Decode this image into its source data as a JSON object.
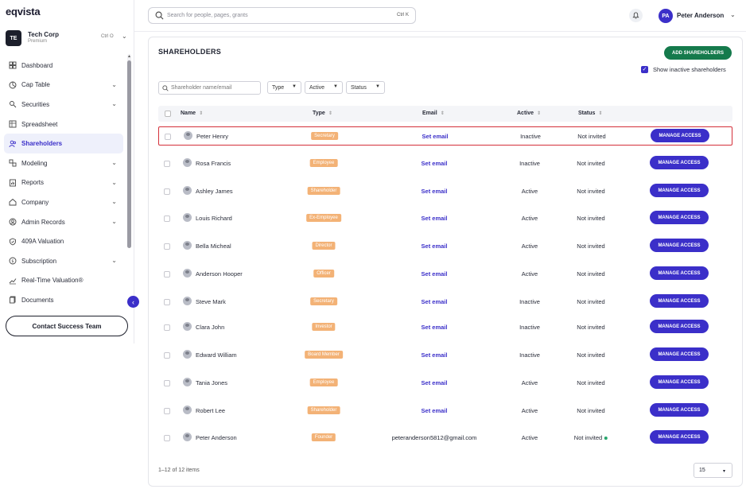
{
  "app": {
    "logo": "eqvista"
  },
  "company": {
    "initials": "TE",
    "name": "Tech Corp",
    "plan": "Premium",
    "shortcut": "Ctrl O"
  },
  "sidebar": {
    "items": [
      {
        "label": "Dashboard",
        "icon": "dashboard-icon",
        "has_chevron": false,
        "active": false
      },
      {
        "label": "Cap Table",
        "icon": "cap-table-icon",
        "has_chevron": true,
        "active": false
      },
      {
        "label": "Securities",
        "icon": "securities-icon",
        "has_chevron": true,
        "active": false
      },
      {
        "label": "Spreadsheet",
        "icon": "spreadsheet-icon",
        "has_chevron": false,
        "active": false
      },
      {
        "label": "Shareholders",
        "icon": "users-icon",
        "has_chevron": false,
        "active": true
      },
      {
        "label": "Modeling",
        "icon": "modeling-icon",
        "has_chevron": true,
        "active": false
      },
      {
        "label": "Reports",
        "icon": "reports-icon",
        "has_chevron": true,
        "active": false
      },
      {
        "label": "Company",
        "icon": "company-icon",
        "has_chevron": true,
        "active": false
      },
      {
        "label": "Admin Records",
        "icon": "admin-records-icon",
        "has_chevron": true,
        "active": false
      },
      {
        "label": "409A Valuation",
        "icon": "shield-icon",
        "has_chevron": false,
        "active": false
      },
      {
        "label": "Subscription",
        "icon": "subscription-icon",
        "has_chevron": true,
        "active": false
      },
      {
        "label": "Real-Time Valuation®",
        "icon": "chart-line-icon",
        "has_chevron": false,
        "active": false
      },
      {
        "label": "Documents",
        "icon": "documents-icon",
        "has_chevron": false,
        "active": false
      }
    ],
    "contact_button": "Contact Success Team"
  },
  "topbar": {
    "search_placeholder": "Search for people, pages, grants",
    "search_shortcut": "Ctrl K",
    "user_initials": "PA",
    "user_name": "Peter Anderson"
  },
  "main": {
    "title": "SHAREHOLDERS",
    "add_button": "ADD SHAREHOLDERS",
    "show_inactive_label": "Show inactive shareholders",
    "show_inactive_checked": true,
    "filter_placeholder": "Shareholder name/email",
    "filters": {
      "type": "Type",
      "active": "Active",
      "status": "Status"
    },
    "columns": {
      "name": "Name",
      "type": "Type",
      "email": "Email",
      "active": "Active",
      "status": "Status"
    },
    "manage_label": "MANAGE ACCESS",
    "rows": [
      {
        "name": "Peter Henry",
        "type": "Secretary",
        "email": "Set email",
        "active": "Inactive",
        "status": "Not invited"
      },
      {
        "name": "Rosa Francis",
        "type": "Employee",
        "email": "Set email",
        "active": "Inactive",
        "status": "Not invited"
      },
      {
        "name": "Ashley James",
        "type": "Shareholder",
        "email": "Set email",
        "active": "Active",
        "status": "Not invited"
      },
      {
        "name": "Louis Richard",
        "type": "Ex-Employee",
        "email": "Set email",
        "active": "Active",
        "status": "Not invited"
      },
      {
        "name": "Bella Micheal",
        "type": "Director",
        "email": "Set email",
        "active": "Active",
        "status": "Not invited"
      },
      {
        "name": "Anderson Hooper",
        "type": "Officer",
        "email": "Set email",
        "active": "Active",
        "status": "Not invited"
      },
      {
        "name": "Steve Mark",
        "type": "Secretary",
        "email": "Set email",
        "active": "Inactive",
        "status": "Not invited"
      },
      {
        "name": "Clara John",
        "type": "Investor",
        "email": "Set email",
        "active": "Inactive",
        "status": "Not invited"
      },
      {
        "name": "Edward William",
        "type": "Board Member",
        "email": "Set email",
        "active": "Inactive",
        "status": "Not invited"
      },
      {
        "name": "Tania Jones",
        "type": "Employee",
        "email": "Set email",
        "active": "Active",
        "status": "Not invited"
      },
      {
        "name": "Robert Lee",
        "type": "Shareholder",
        "email": "Set email",
        "active": "Active",
        "status": "Not invited"
      },
      {
        "name": "Peter Anderson",
        "type": "Founder",
        "email": "peteranderson5812@gmail.com",
        "active": "Active",
        "status": "Not invited"
      }
    ],
    "pagination_info": "1–12 of 12 items",
    "page_size": "15"
  },
  "colors": {
    "accent": "#3b2fc9",
    "add_button": "#157a4c",
    "type_badge": "#f3b276",
    "highlight_border": "#d4303a",
    "online_dot": "#28a66d"
  }
}
